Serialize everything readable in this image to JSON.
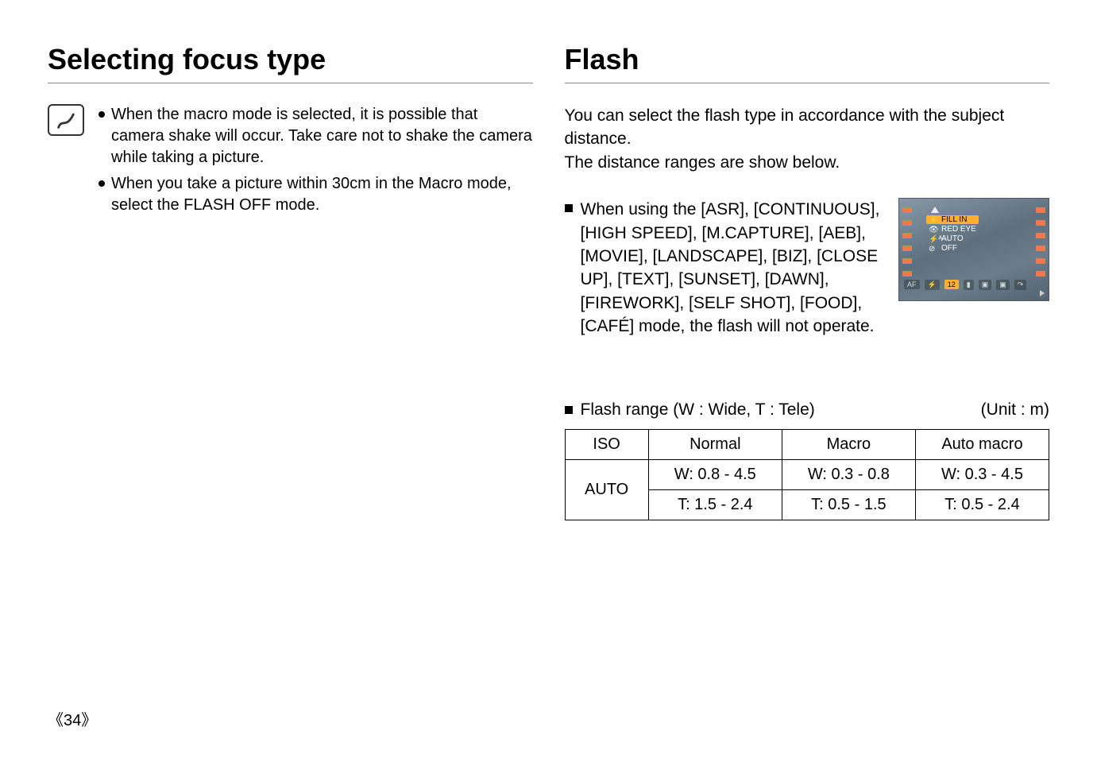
{
  "left": {
    "heading": "Selecting focus type",
    "bullets": [
      "When the macro mode is selected, it is possible that camera shake will occur. Take care not to shake the camera while taking a picture.",
      "When you take a picture within 30cm in the Macro mode, select the FLASH OFF mode."
    ]
  },
  "right": {
    "heading": "Flash",
    "intro1": "You can select the flash type in accordance with the subject distance.",
    "intro2": "The distance ranges are show below.",
    "modes_note": "When using the [ASR], [CONTINUOUS], [HIGH SPEED], [M.CAPTURE], [AEB], [MOVIE], [LANDSCAPE], [BIZ], [CLOSE UP], [TEXT], [SUNSET], [DAWN], [FIREWORK], [SELF SHOT], [FOOD], [CAFÉ] mode, the flash will not operate.",
    "camera_menu": [
      "FILL IN",
      "RED EYE",
      "AUTO",
      "OFF"
    ],
    "camera_selected_index": 0,
    "camera_bottom": {
      "af": "AF",
      "count": "12"
    },
    "range_label": "Flash range (W : Wide, T : Tele)",
    "range_unit": "(Unit : m)",
    "table": {
      "headers": [
        "ISO",
        "Normal",
        "Macro",
        "Auto macro"
      ],
      "iso_label": "AUTO",
      "rows": [
        [
          "W: 0.8 - 4.5",
          "W: 0.3 - 0.8",
          "W: 0.3 - 4.5"
        ],
        [
          "T: 1.5 - 2.4",
          "T: 0.5 - 1.5",
          "T: 0.5 - 2.4"
        ]
      ]
    }
  },
  "page_number": "34",
  "chart_data": {
    "type": "table",
    "title": "Flash range (W : Wide, T : Tele)",
    "unit": "m",
    "iso": "AUTO",
    "columns": [
      "Normal",
      "Macro",
      "Auto macro"
    ],
    "wide": {
      "Normal": [
        0.8,
        4.5
      ],
      "Macro": [
        0.3,
        0.8
      ],
      "Auto macro": [
        0.3,
        4.5
      ]
    },
    "tele": {
      "Normal": [
        1.5,
        2.4
      ],
      "Macro": [
        0.5,
        1.5
      ],
      "Auto macro": [
        0.5,
        2.4
      ]
    }
  }
}
